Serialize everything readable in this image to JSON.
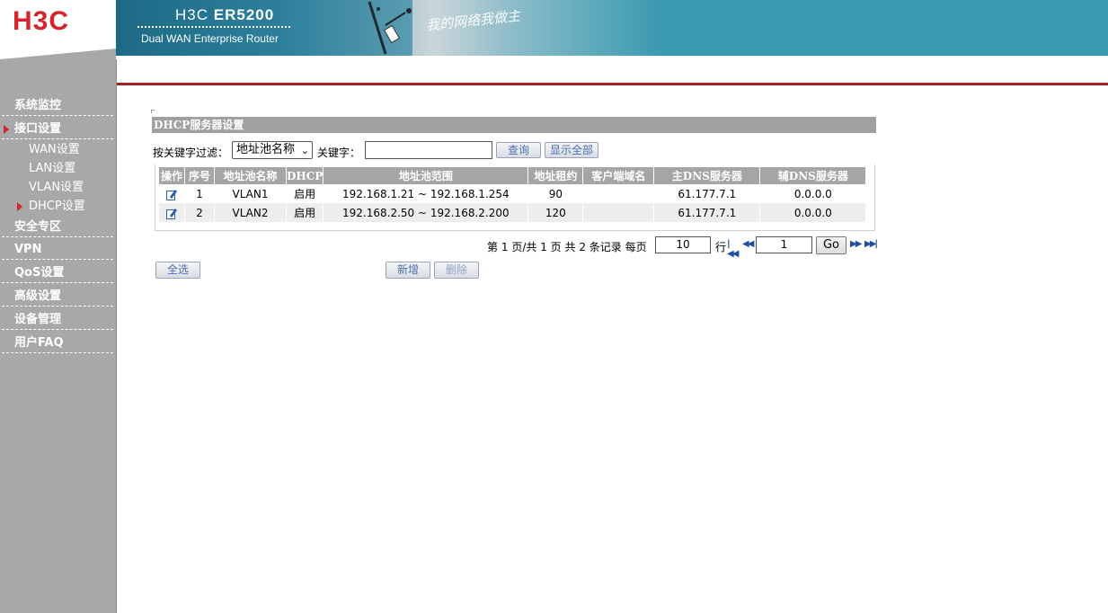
{
  "header": {
    "logo": "H3C",
    "model_prefix": "H3C",
    "model": "ER5200",
    "subtitle": "Dual WAN Enterprise Router",
    "slogan": "我的网络我做主",
    "accent_color": "#a3232b",
    "logo_color": "#d3252a"
  },
  "sidebar": {
    "items": [
      {
        "label": "系统监控",
        "active": false
      },
      {
        "label": "接口设置",
        "active": true
      },
      {
        "label": "安全专区",
        "active": false
      },
      {
        "label": "VPN",
        "active": false
      },
      {
        "label": "QoS设置",
        "active": false
      },
      {
        "label": "高级设置",
        "active": false
      },
      {
        "label": "设备管理",
        "active": false
      },
      {
        "label": "用户FAQ",
        "active": false
      }
    ],
    "subitems": [
      {
        "label": "WAN设置",
        "active": false
      },
      {
        "label": "LAN设置",
        "active": false
      },
      {
        "label": "VLAN设置",
        "active": false
      },
      {
        "label": "DHCP设置",
        "active": true
      }
    ]
  },
  "panel": {
    "title": "DHCP服务器设置",
    "filter": {
      "label": "按关键字过滤：",
      "select_value": "地址池名称",
      "keyword_label": "关键字：",
      "keyword_value": "",
      "search_button": "查询",
      "show_all_button": "显示全部"
    },
    "table": {
      "columns": [
        "操作",
        "序号",
        "地址池名称",
        "DHCP",
        "地址池范围",
        "地址租约",
        "客户端域名",
        "主DNS服务器",
        "辅DNS服务器"
      ],
      "rows": [
        {
          "action_icon": "edit-icon",
          "index": "1",
          "name": "VLAN1",
          "dhcp": "启用",
          "range": "192.168.1.21 ~ 192.168.1.254",
          "lease": "90",
          "domain": "",
          "dns1": "61.177.7.1",
          "dns2": "0.0.0.0"
        },
        {
          "action_icon": "edit-icon",
          "index": "2",
          "name": "VLAN2",
          "dhcp": "启用",
          "range": "192.168.2.50 ~ 192.168.2.200",
          "lease": "120",
          "domain": "",
          "dns1": "61.177.7.1",
          "dns2": "0.0.0.0"
        }
      ]
    },
    "pager": {
      "p1": "第",
      "current_page": "1",
      "p2": "页/共",
      "total_pages": "1",
      "p3": "页 共",
      "total_records": "2",
      "p4": "条记录 每页",
      "per_page": "10",
      "p5": "行",
      "goto_value": "1",
      "go_button": "Go"
    },
    "buttons": {
      "select_all": "全选",
      "add": "新增",
      "delete": "删除"
    }
  }
}
